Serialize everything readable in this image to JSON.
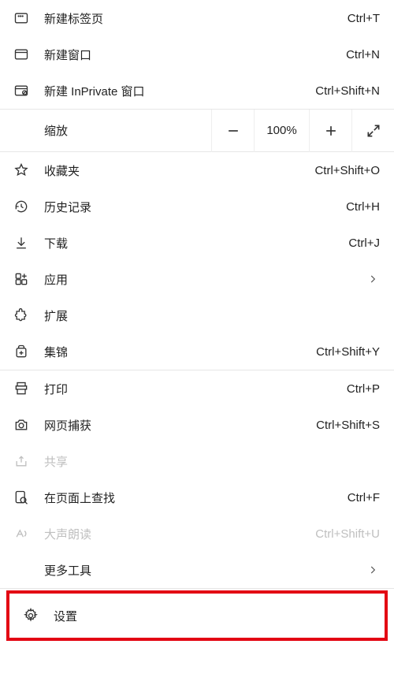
{
  "group1": {
    "new_tab": {
      "label": "新建标签页",
      "shortcut": "Ctrl+T"
    },
    "new_window": {
      "label": "新建窗口",
      "shortcut": "Ctrl+N"
    },
    "new_inprivate": {
      "label": "新建 InPrivate 窗口",
      "shortcut": "Ctrl+Shift+N"
    }
  },
  "zoom": {
    "label": "缩放",
    "value": "100%"
  },
  "group2": {
    "favorites": {
      "label": "收藏夹",
      "shortcut": "Ctrl+Shift+O"
    },
    "history": {
      "label": "历史记录",
      "shortcut": "Ctrl+H"
    },
    "downloads": {
      "label": "下载",
      "shortcut": "Ctrl+J"
    },
    "apps": {
      "label": "应用"
    },
    "extensions": {
      "label": "扩展"
    },
    "collections": {
      "label": "集锦",
      "shortcut": "Ctrl+Shift+Y"
    }
  },
  "group3": {
    "print": {
      "label": "打印",
      "shortcut": "Ctrl+P"
    },
    "capture": {
      "label": "网页捕获",
      "shortcut": "Ctrl+Shift+S"
    },
    "share": {
      "label": "共享"
    },
    "find": {
      "label": "在页面上查找",
      "shortcut": "Ctrl+F"
    },
    "read_aloud": {
      "label": "大声朗读",
      "shortcut": "Ctrl+Shift+U"
    },
    "more_tools": {
      "label": "更多工具"
    }
  },
  "settings": {
    "label": "设置"
  }
}
